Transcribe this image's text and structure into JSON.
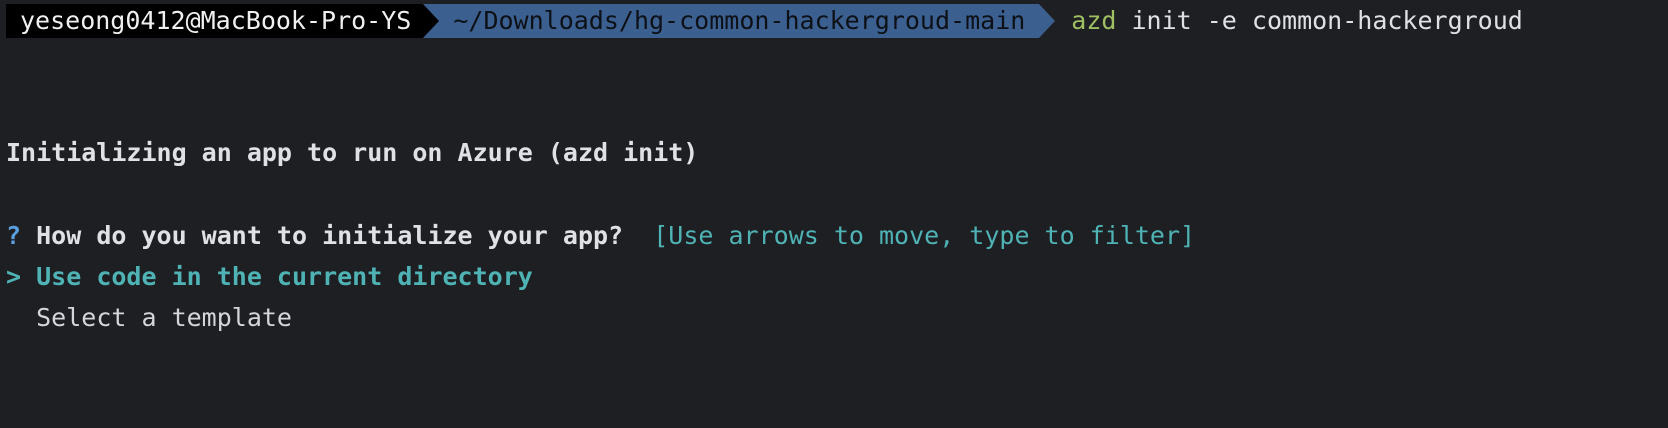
{
  "prompt": {
    "host": "yeseong0412@MacBook-Pro-YS",
    "path": "~/Downloads/hg-common-hackergroud-main",
    "command_name": "azd",
    "command_args": " init -e common-hackergroud"
  },
  "output": {
    "heading": "Initializing an app to run on Azure (azd init)",
    "question_mark": "?",
    "question": " How do you want to initialize your app?",
    "hint": "  [Use arrows to move, type to filter]",
    "options": [
      {
        "marker": "> ",
        "label": "Use code in the current directory",
        "selected": true
      },
      {
        "marker": "  ",
        "label": "Select a template",
        "selected": false
      }
    ]
  },
  "colors": {
    "background": "#1e1f22",
    "path_segment": "#3b5f8f",
    "command": "#9fbf63",
    "accent": "#4fb3b5",
    "question_mark": "#5aa0e0"
  }
}
